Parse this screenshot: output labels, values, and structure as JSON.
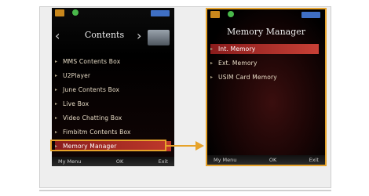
{
  "left_screen": {
    "title": "Contents",
    "items": [
      {
        "label": "MMS Contents Box",
        "selected": false
      },
      {
        "label": "U2Player",
        "selected": false
      },
      {
        "label": "June Contents Box",
        "selected": false
      },
      {
        "label": "Live Box",
        "selected": false
      },
      {
        "label": "Video Chatting Box",
        "selected": false
      },
      {
        "label": "Fimbitm Contents Box",
        "selected": false
      },
      {
        "label": "Memory Manager",
        "selected": true
      }
    ],
    "softkeys": {
      "left": "My Menu",
      "center": "OK",
      "right": "Exit"
    }
  },
  "right_screen": {
    "title": "Memory Manager",
    "items": [
      {
        "label": "Int. Memory",
        "selected": true
      },
      {
        "label": "Ext. Memory",
        "selected": false
      },
      {
        "label": "USIM Card Memory",
        "selected": false
      }
    ],
    "softkeys": {
      "left": "My Menu",
      "center": "OK",
      "right": "Exit"
    }
  },
  "colors": {
    "accent_orange": "#e6a22a",
    "selection_red": "#c0392b",
    "panel_gray": "#eeeeee"
  },
  "icons": {
    "status_mail": "mail-icon",
    "status_signal": "signal-icon",
    "status_battery": "battery-icon",
    "folder": "folder-icon"
  }
}
